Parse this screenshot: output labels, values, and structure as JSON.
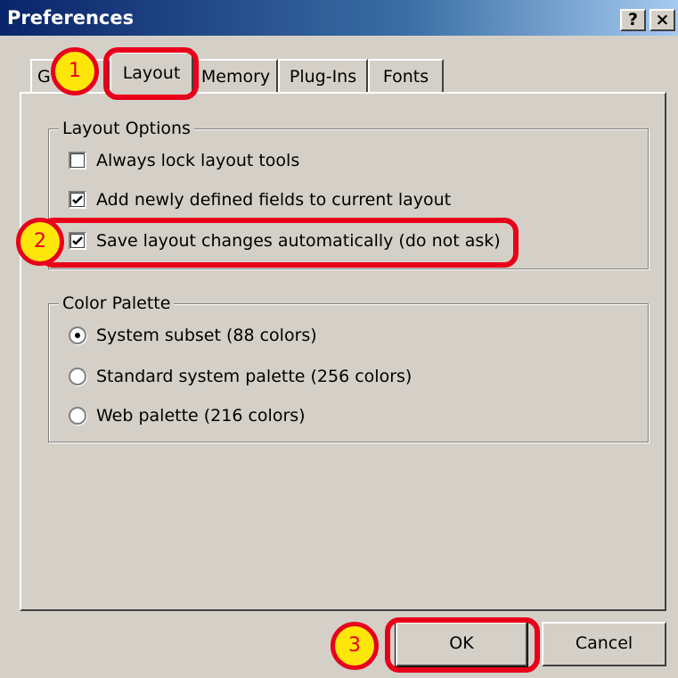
{
  "window": {
    "title": "Preferences",
    "help_button": "?",
    "close_button": "×"
  },
  "tabs": [
    {
      "label": "G",
      "active": false
    },
    {
      "label": "Layout",
      "active": true
    },
    {
      "label": "Memory",
      "active": false
    },
    {
      "label": "Plug-Ins",
      "active": false
    },
    {
      "label": "Fonts",
      "active": false
    }
  ],
  "layout_options": {
    "group_label": "Layout Options",
    "items": [
      {
        "label": "Always lock layout tools",
        "checked": false
      },
      {
        "label": "Add newly defined fields to current layout",
        "checked": true
      },
      {
        "label": "Save layout changes automatically (do not ask)",
        "checked": true
      }
    ]
  },
  "color_palette": {
    "group_label": "Color Palette",
    "options": [
      {
        "label": "System subset (88 colors)",
        "selected": true
      },
      {
        "label": "Standard system palette (256 colors)",
        "selected": false
      },
      {
        "label": "Web palette (216 colors)",
        "selected": false
      }
    ]
  },
  "buttons": {
    "ok": "OK",
    "cancel": "Cancel"
  },
  "annotations": {
    "step1": "1",
    "step2": "2",
    "step3": "3",
    "color": "#e8001a",
    "badge_fill": "#ffe60a"
  }
}
